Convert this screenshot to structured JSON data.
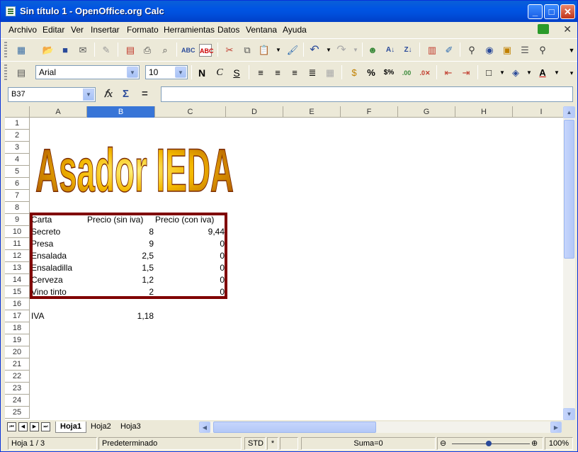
{
  "window": {
    "title": "Sin título 1 - OpenOffice.org Calc"
  },
  "menu": [
    "Archivo",
    "Editar",
    "Ver",
    "Insertar",
    "Formato",
    "Herramientas",
    "Datos",
    "Ventana",
    "Ayuda"
  ],
  "toolbar": {
    "font_name": "Arial",
    "font_size": "10",
    "bold": "N",
    "italic": "C",
    "underline": "S"
  },
  "formula_bar": {
    "cell_ref": "B37",
    "value": ""
  },
  "columns": [
    "A",
    "B",
    "C",
    "D",
    "E",
    "F",
    "G",
    "H",
    "I"
  ],
  "selected_column": "B",
  "rows": [
    "1",
    "2",
    "3",
    "4",
    "5",
    "6",
    "7",
    "8",
    "9",
    "10",
    "11",
    "12",
    "13",
    "14",
    "15",
    "16",
    "17",
    "18",
    "19",
    "20",
    "21",
    "22",
    "23",
    "24",
    "25"
  ],
  "wordart": "Asador IEDA",
  "table": {
    "headers": [
      "Carta",
      "Precio (sin iva)",
      "Precio (con iva)"
    ],
    "rows": [
      [
        "Secreto",
        "8",
        "9,44"
      ],
      [
        "Presa",
        "9",
        "0"
      ],
      [
        "Ensalada",
        "2,5",
        "0"
      ],
      [
        "Ensaladilla",
        "1,5",
        "0"
      ],
      [
        "Cerveza",
        "1,2",
        "0"
      ],
      [
        "Vino tinto",
        "2",
        "0"
      ]
    ]
  },
  "iva": {
    "label": "IVA",
    "value": "1,18"
  },
  "sheets": [
    "Hoja1",
    "Hoja2",
    "Hoja3"
  ],
  "active_sheet": "Hoja1",
  "status": {
    "page": "Hoja 1 / 3",
    "style": "Predeterminado",
    "mode": "STD",
    "modified": "*",
    "sum": "Suma=0",
    "zoom": "100%"
  }
}
